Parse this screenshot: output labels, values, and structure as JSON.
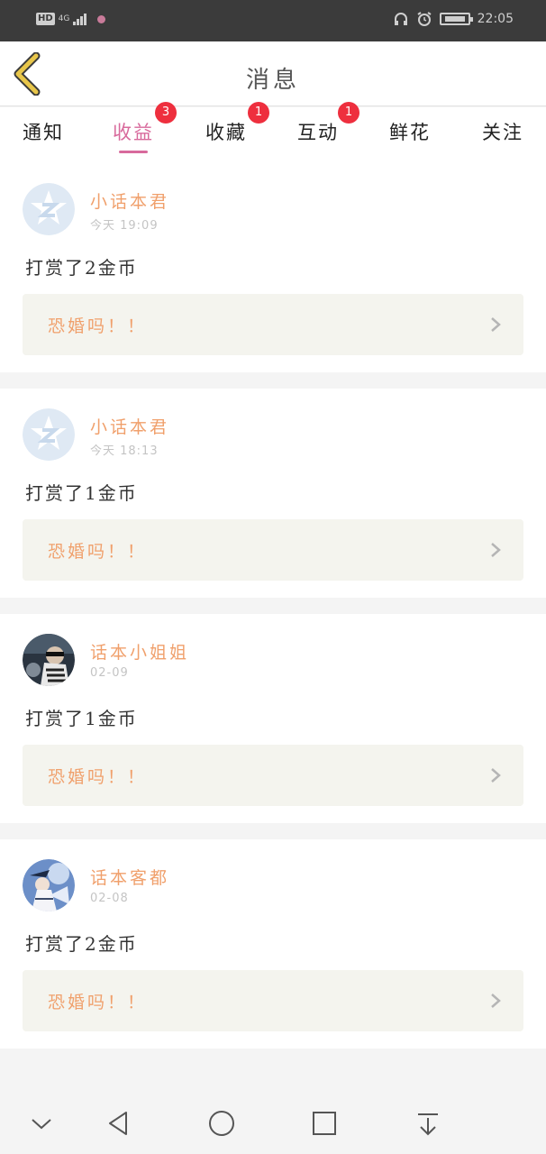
{
  "status_bar": {
    "network": "HD",
    "signal": "4G",
    "time": "22:05"
  },
  "header": {
    "title": "消息"
  },
  "tabs": [
    {
      "label": "通知",
      "badge": ""
    },
    {
      "label": "收益",
      "badge": "3",
      "active": true
    },
    {
      "label": "收藏",
      "badge": "1"
    },
    {
      "label": "互动",
      "badge": "1"
    },
    {
      "label": "鲜花",
      "badge": ""
    },
    {
      "label": "关注",
      "badge": ""
    }
  ],
  "messages": [
    {
      "sender": "小话本君",
      "time": "今天 19:09",
      "text": "打赏了2金币",
      "work_title": "恐婚吗！！",
      "avatar": "default-logo"
    },
    {
      "sender": "小话本君",
      "time": "今天 18:13",
      "text": "打赏了1金币",
      "work_title": "恐婚吗！！",
      "avatar": "default-logo"
    },
    {
      "sender": "话本小姐姐",
      "time": "02-09",
      "text": "打赏了1金币",
      "work_title": "恐婚吗！！",
      "avatar": "photo"
    },
    {
      "sender": "话本客都",
      "time": "02-08",
      "text": "打赏了2金币",
      "work_title": "恐婚吗！！",
      "avatar": "photo"
    }
  ],
  "colors": {
    "accent": "#d86a9c",
    "name": "#f0a06c",
    "badge": "#ee2f3e",
    "back_arrow": "#e8c64a"
  }
}
